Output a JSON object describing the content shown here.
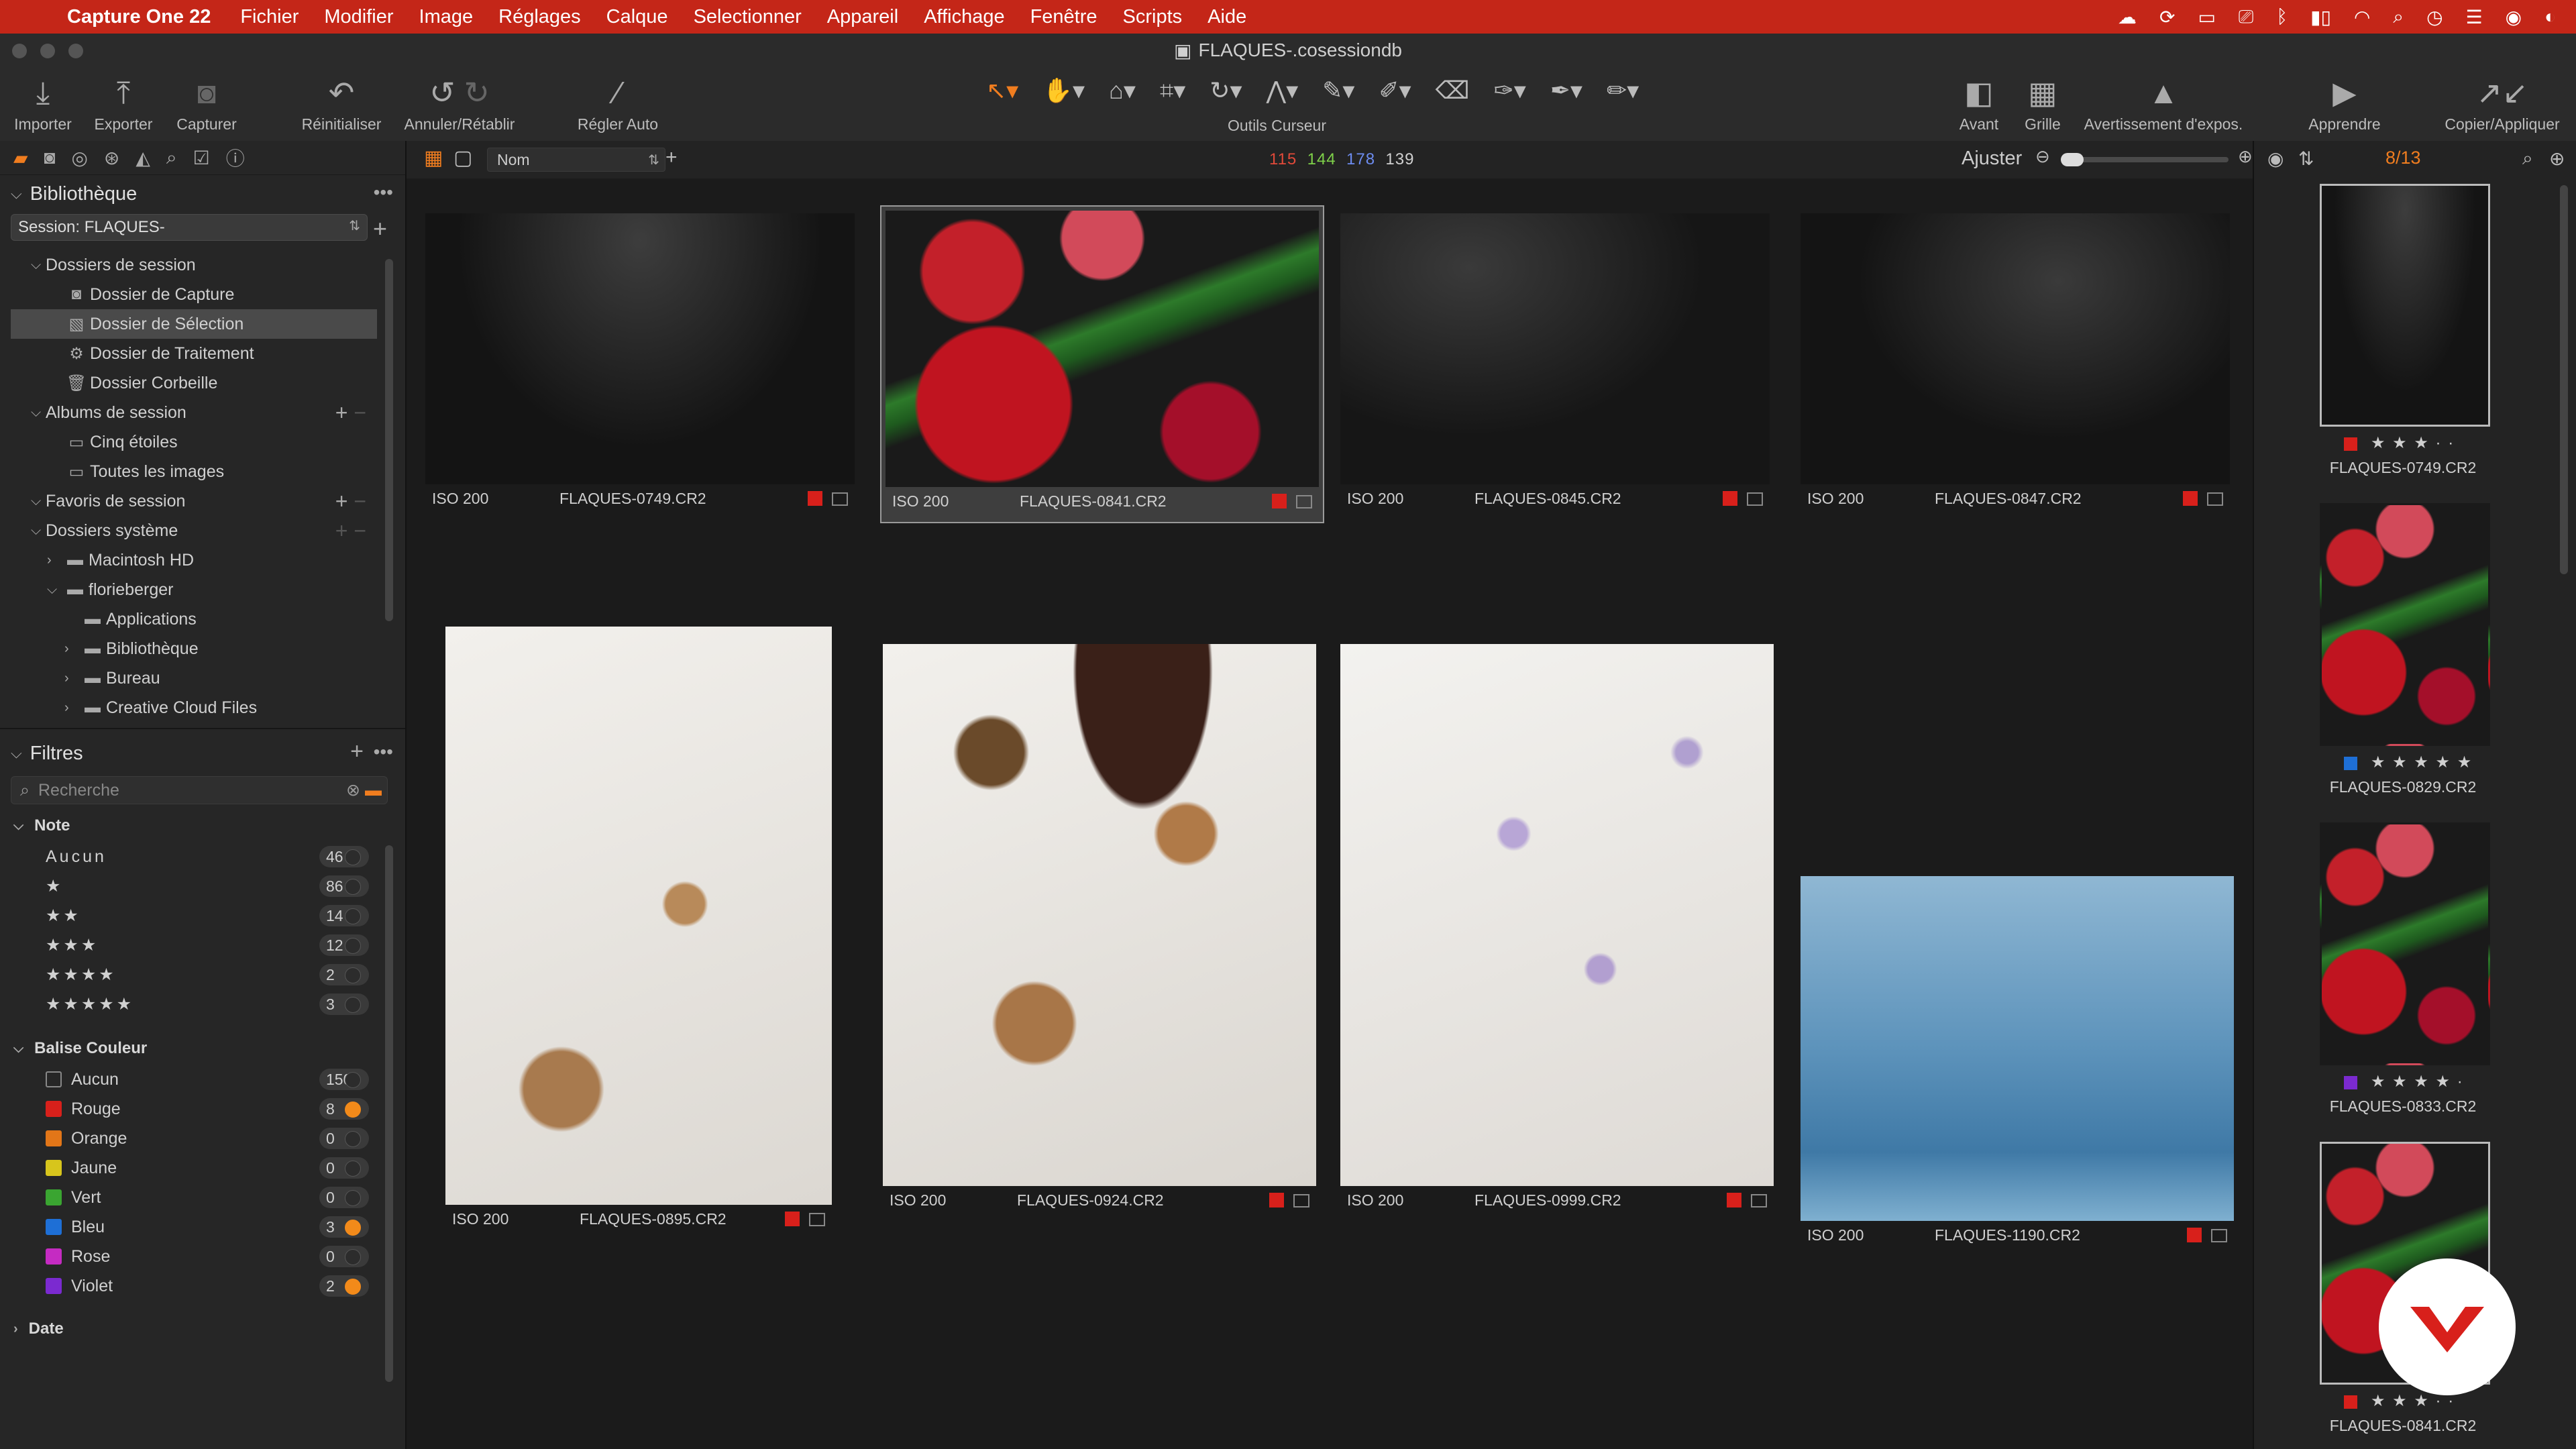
{
  "menubar": {
    "app": "Capture One 22",
    "items": [
      "Fichier",
      "Modifier",
      "Image",
      "Réglages",
      "Calque",
      "Selectionner",
      "Appareil",
      "Affichage",
      "Fenêtre",
      "Scripts",
      "Aide"
    ]
  },
  "window": {
    "title": "FLAQUES-.cosessiondb"
  },
  "toolbar": {
    "importer": "Importer",
    "exporter": "Exporter",
    "capturer": "Capturer",
    "reinitialiser": "Réinitialiser",
    "annuler": "Annuler/Rétablir",
    "regler_auto": "Régler Auto",
    "outils_curseur": "Outils Curseur",
    "avant": "Avant",
    "grille": "Grille",
    "avertissement": "Avertissement d'expos.",
    "apprendre": "Apprendre",
    "copier": "Copier/Appliquer"
  },
  "library": {
    "title": "Bibliothèque",
    "session": "Session: FLAQUES-",
    "session_folders": {
      "label": "Dossiers de session",
      "items": [
        "Dossier de Capture",
        "Dossier de Sélection",
        "Dossier de Traitement",
        "Dossier Corbeille"
      ]
    },
    "albums": {
      "label": "Albums de session",
      "items": [
        "Cinq étoiles",
        "Toutes les images"
      ]
    },
    "favorites": {
      "label": "Favoris de session"
    },
    "system": {
      "label": "Dossiers système",
      "items": [
        "Macintosh HD",
        "florieberger",
        "Applications",
        "Bibliothèque",
        "Bureau",
        "Creative Cloud Files"
      ]
    }
  },
  "filters": {
    "title": "Filtres",
    "search_placeholder": "Recherche",
    "note": {
      "label": "Note",
      "rows": [
        {
          "label": "Aucun",
          "count": "46"
        },
        {
          "label": "★",
          "count": "86"
        },
        {
          "label": "★★",
          "count": "14"
        },
        {
          "label": "★★★",
          "count": "12"
        },
        {
          "label": "★★★★",
          "count": "2"
        },
        {
          "label": "★★★★★",
          "count": "3"
        }
      ]
    },
    "color": {
      "label": "Balise Couleur",
      "rows": [
        {
          "label": "Aucun",
          "count": "150",
          "color": "none",
          "active": false
        },
        {
          "label": "Rouge",
          "count": "8",
          "color": "#d8201b",
          "active": true
        },
        {
          "label": "Orange",
          "count": "0",
          "color": "#e27618",
          "active": false
        },
        {
          "label": "Jaune",
          "count": "0",
          "color": "#d7c51c",
          "active": false
        },
        {
          "label": "Vert",
          "count": "0",
          "color": "#3aa531",
          "active": false
        },
        {
          "label": "Bleu",
          "count": "3",
          "color": "#1e6fd6",
          "active": true
        },
        {
          "label": "Rose",
          "count": "0",
          "color": "#c52bc2",
          "active": false
        },
        {
          "label": "Violet",
          "count": "2",
          "color": "#7b2ad0",
          "active": true
        }
      ]
    },
    "date": "Date"
  },
  "viewer": {
    "sort": "Nom",
    "counts": [
      {
        "value": "115",
        "color": "#e24a3a"
      },
      {
        "value": "144",
        "color": "#7fd14a"
      },
      {
        "value": "178",
        "color": "#6d8cf0"
      },
      {
        "value": "139",
        "color": "#d0d0d0"
      }
    ],
    "zoom_label": "Ajuster"
  },
  "grid": [
    {
      "iso": "ISO 200",
      "name": "FLAQUES-0749.CR2",
      "selected": false,
      "kind": "rock1"
    },
    {
      "iso": "ISO 200",
      "name": "FLAQUES-0841.CR2",
      "selected": true,
      "kind": "flowers"
    },
    {
      "iso": "ISO 200",
      "name": "FLAQUES-0845.CR2",
      "selected": false,
      "kind": "rock2"
    },
    {
      "iso": "ISO 200",
      "name": "FLAQUES-0847.CR2",
      "selected": false,
      "kind": "rock3"
    },
    {
      "iso": "ISO 200",
      "name": "FLAQUES-0895.CR2",
      "selected": false,
      "kind": "white1"
    },
    {
      "iso": "ISO 200",
      "name": "FLAQUES-0924.CR2",
      "selected": false,
      "kind": "white2"
    },
    {
      "iso": "ISO 200",
      "name": "FLAQUES-0999.CR2",
      "selected": false,
      "kind": "white3"
    },
    {
      "iso": "ISO 200",
      "name": "FLAQUES-1190.CR2",
      "selected": false,
      "kind": "water"
    }
  ],
  "filmstrip": {
    "position": "8/13",
    "items": [
      {
        "name": "FLAQUES-0749.CR2",
        "stars": "★ ★ ★ · ·",
        "tag": "#d8201b"
      },
      {
        "name": "FLAQUES-0829.CR2",
        "stars": "★ ★ ★ ★ ★",
        "tag": "#1e6fd6"
      },
      {
        "name": "FLAQUES-0833.CR2",
        "stars": "★ ★ ★ ★ ·",
        "tag": "#7b2ad0"
      },
      {
        "name": "FLAQUES-0841.CR2",
        "stars": "★ ★ ★ · ·",
        "tag": "#d8201b"
      }
    ]
  }
}
